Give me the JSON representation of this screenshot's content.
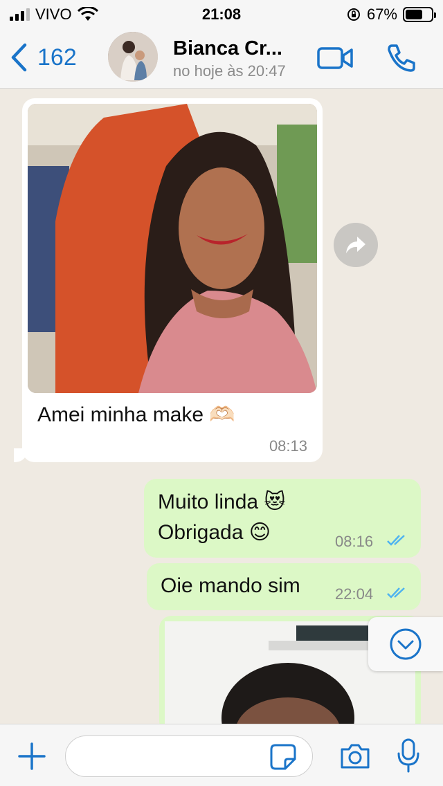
{
  "status_bar": {
    "carrier": "VIVO",
    "time": "21:08",
    "battery": "67%",
    "battery_level": 0.67
  },
  "header": {
    "back_count": "162",
    "contact_name": "Bianca Cr...",
    "last_seen": "no hoje às 20:47",
    "icons": [
      "chevron-left-icon",
      "video-call-icon",
      "phone-icon"
    ]
  },
  "messages": [
    {
      "direction": "incoming",
      "type": "image",
      "caption": "Amei minha make 🫶🏻",
      "time": "08:13"
    },
    {
      "direction": "outgoing",
      "line1": "Muito linda 😻",
      "line2": "Obrigada 😊",
      "time": "08:16",
      "status": "read"
    },
    {
      "direction": "outgoing",
      "text": "Oie mando sim",
      "time": "22:04",
      "status": "read"
    },
    {
      "direction": "outgoing",
      "type": "image"
    }
  ],
  "input_bar": {
    "placeholder": "",
    "icons": [
      "plus-icon",
      "sticker-icon",
      "camera-icon",
      "microphone-icon"
    ]
  },
  "colors": {
    "accent": "#1a74c9",
    "outgoing_bubble": "#dcf8c6",
    "incoming_bubble": "#ffffff",
    "chat_background": "#efeae2",
    "read_ticks": "#4fb3f0"
  }
}
